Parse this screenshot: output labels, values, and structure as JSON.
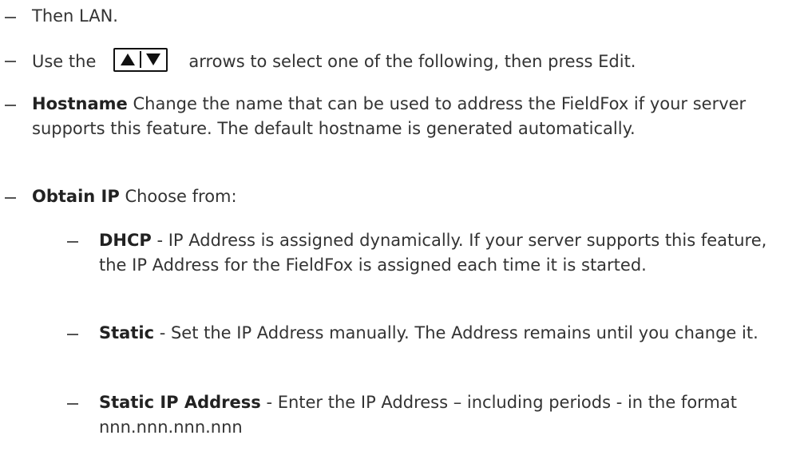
{
  "steps": {
    "lan": "Then LAN.",
    "arrows_before": "Use the",
    "arrows_after": "arrows to select one of the following, then press Edit.",
    "hostname_term": "Hostname",
    "hostname_desc": " Change the name that can be used to address the FieldFox if your server supports this feature. The default hostname is generated automatically.",
    "obtain_term": "Obtain IP",
    "obtain_desc": " Choose from:"
  },
  "options": {
    "dhcp_term": "DHCP",
    "dhcp_desc": " - IP Address is assigned dynamically. If your server supports this feature, the IP Address for the FieldFox is assigned each time it is started.",
    "static_term": "Static",
    "static_desc": " - Set the IP Address manually. The Address remains until you change it.",
    "static_ip_term": "Static IP Address",
    "static_ip_desc": " - Enter the IP Address – including periods - in the format nnn.nnn.nnn.nnn"
  },
  "icons": {
    "arrow_keys": "up-down-arrow-keys-icon"
  }
}
